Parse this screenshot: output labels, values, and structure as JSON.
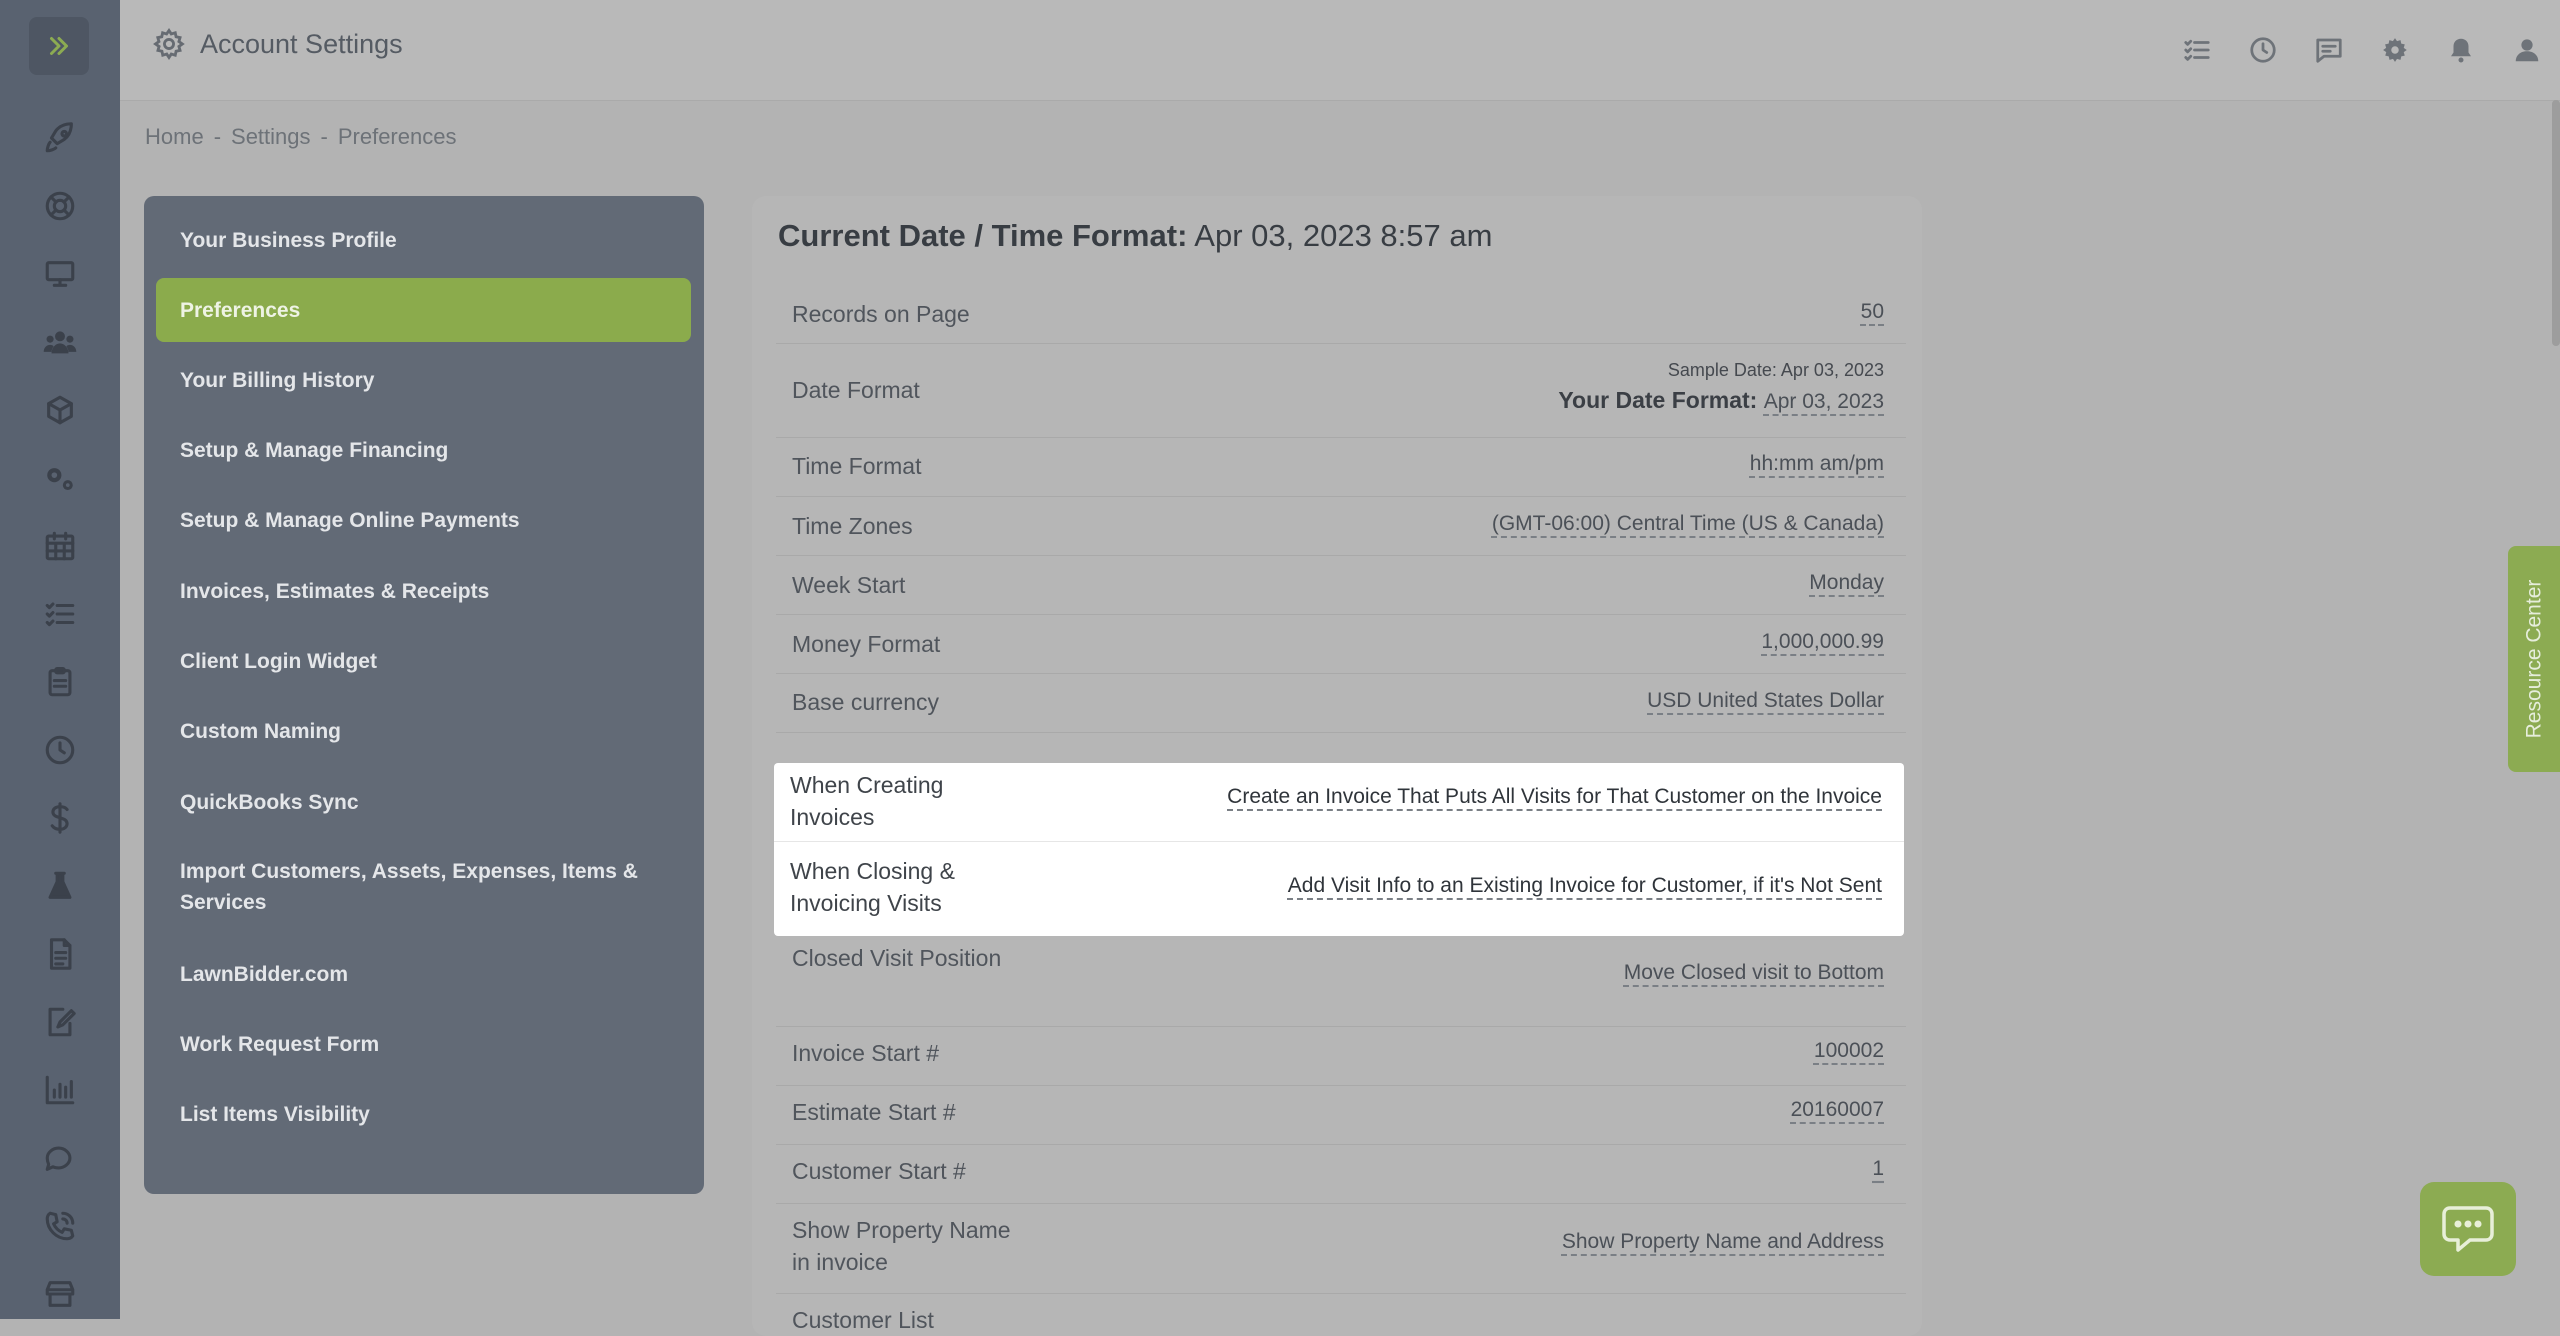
{
  "header": {
    "title": "Account Settings"
  },
  "breadcrumb": {
    "home": "Home",
    "settings": "Settings",
    "current": "Preferences",
    "sep": "-"
  },
  "menu": {
    "items": [
      {
        "label": "Your Business Profile"
      },
      {
        "label": "Preferences",
        "active": true
      },
      {
        "label": "Your Billing History"
      },
      {
        "label": "Setup & Manage Financing"
      },
      {
        "label": "Setup & Manage Online Payments"
      },
      {
        "label": "Invoices, Estimates & Receipts"
      },
      {
        "label": "Client Login Widget"
      },
      {
        "label": "Custom Naming"
      },
      {
        "label": "QuickBooks Sync"
      },
      {
        "label": "Import Customers, Assets, Expenses, Items & Services"
      },
      {
        "label": "LawnBidder.com"
      },
      {
        "label": "Work Request Form"
      },
      {
        "label": "List Items Visibility"
      }
    ]
  },
  "content": {
    "head_label": "Current Date / Time Format:",
    "head_value": "Apr 03, 2023 8:57 am",
    "date_sample": "Sample Date: Apr 03, 2023",
    "your_date_label": "Your Date Format:",
    "your_date_value": "Apr 03, 2023",
    "rows": [
      {
        "label": "Records on Page",
        "value": "50"
      },
      {
        "label": "Date Format",
        "value": ""
      },
      {
        "label": "Time Format",
        "value": "hh:mm am/pm"
      },
      {
        "label": "Time Zones",
        "value": "(GMT-06:00) Central Time (US & Canada)"
      },
      {
        "label": "Week Start",
        "value": "Monday"
      },
      {
        "label": "Money Format",
        "value": "1,000,000.99"
      },
      {
        "label": "Base currency",
        "value": "USD United States Dollar"
      },
      {
        "label": "When Creating Invoices",
        "value": "Create an Invoice That Puts All Visits for That Customer on the Invoice"
      },
      {
        "label": "When Closing & Invoicing Visits",
        "value": "Add Visit Info to an Existing Invoice for Customer, if it's Not Sent"
      },
      {
        "label": "Closed Visit Position",
        "value": "Move Closed visit to Bottom"
      },
      {
        "label": "Invoice Start #",
        "value": "100002"
      },
      {
        "label": "Estimate Start #",
        "value": "20160007"
      },
      {
        "label": "Customer Start #",
        "value": "1"
      },
      {
        "label": "Show Property Name in invoice",
        "value": "Show Property Name and Address"
      },
      {
        "label": "Customer List",
        "value": ""
      }
    ]
  },
  "resource_center": "Resource Center",
  "icons": {
    "rail": [
      "expand-icon",
      "rocket-icon",
      "support-icon",
      "monitor-icon",
      "users-icon",
      "box-icon",
      "gears-icon",
      "calendar-icon",
      "checklist-icon",
      "clipboard-icon",
      "clock-icon",
      "dollar-icon",
      "flask-icon",
      "document-icon",
      "sign-icon",
      "chart-icon",
      "chat-icon",
      "phone-icon",
      "store-icon"
    ],
    "top": [
      "tasks-icon",
      "history-icon",
      "message-icon",
      "gear-icon",
      "bell-icon",
      "user-icon"
    ]
  }
}
